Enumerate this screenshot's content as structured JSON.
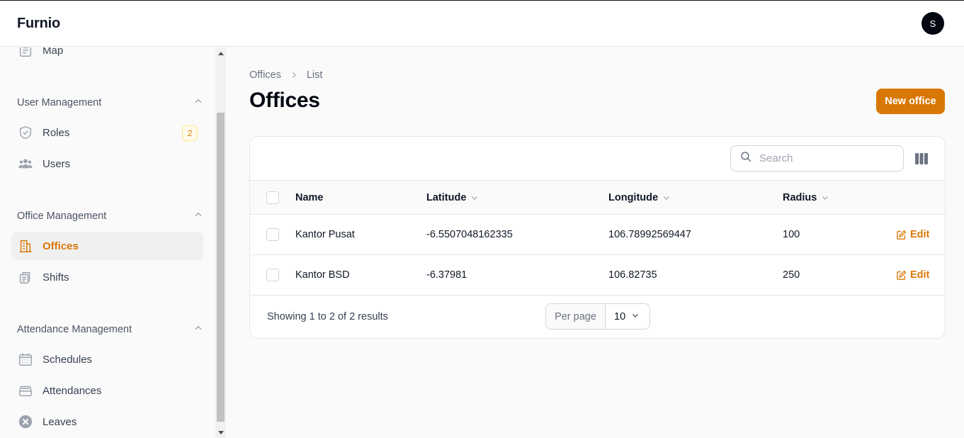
{
  "app": {
    "brand": "Furnio",
    "avatar_initial": "S"
  },
  "sidebar": {
    "partial_item": {
      "label": "Map",
      "icon": "map-document-icon"
    },
    "groups": [
      {
        "label": "User Management",
        "items": [
          {
            "label": "Roles",
            "icon": "shield-check-icon",
            "badge": "2"
          },
          {
            "label": "Users",
            "icon": "users-icon"
          }
        ]
      },
      {
        "label": "Office Management",
        "items": [
          {
            "label": "Offices",
            "icon": "building-icon",
            "active": true
          },
          {
            "label": "Shifts",
            "icon": "shifts-icon"
          }
        ]
      },
      {
        "label": "Attendance Management",
        "items": [
          {
            "label": "Schedules",
            "icon": "calendar-icon"
          },
          {
            "label": "Attendances",
            "icon": "inbox-stack-icon"
          },
          {
            "label": "Leaves",
            "icon": "x-circle-icon"
          }
        ]
      }
    ]
  },
  "breadcrumb": {
    "parent": "Offices",
    "current": "List"
  },
  "page": {
    "title": "Offices",
    "new_button": "New office"
  },
  "table": {
    "search_placeholder": "Search",
    "columns": {
      "name": "Name",
      "latitude": "Latitude",
      "longitude": "Longitude",
      "radius": "Radius"
    },
    "rows": [
      {
        "name": "Kantor Pusat",
        "latitude": "-6.5507048162335",
        "longitude": "106.78992569447",
        "radius": "100",
        "action": "Edit"
      },
      {
        "name": "Kantor BSD",
        "latitude": "-6.37981",
        "longitude": "106.82735",
        "radius": "250",
        "action": "Edit"
      }
    ],
    "showing": "Showing 1 to 2 of 2 results",
    "per_page_label": "Per page",
    "per_page_value": "10"
  },
  "colors": {
    "accent": "#d97706",
    "active_bg": "#f0f0f0"
  }
}
